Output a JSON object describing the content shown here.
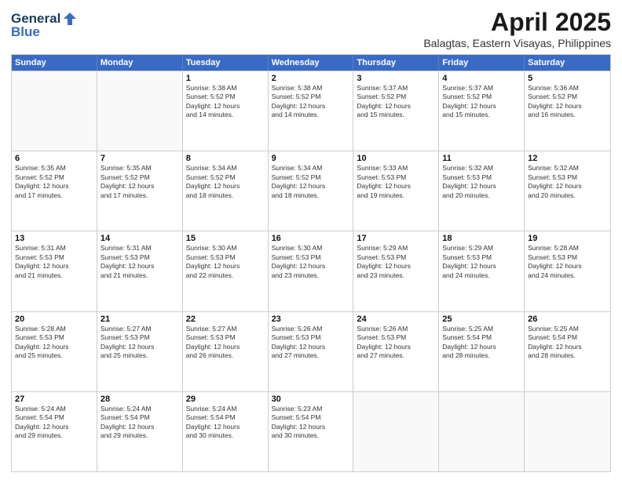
{
  "logo": {
    "line1": "General",
    "line2": "Blue"
  },
  "title": "April 2025",
  "subtitle": "Balagtas, Eastern Visayas, Philippines",
  "weekdays": [
    "Sunday",
    "Monday",
    "Tuesday",
    "Wednesday",
    "Thursday",
    "Friday",
    "Saturday"
  ],
  "weeks": [
    [
      {
        "day": "",
        "info": ""
      },
      {
        "day": "",
        "info": ""
      },
      {
        "day": "1",
        "info": "Sunrise: 5:38 AM\nSunset: 5:52 PM\nDaylight: 12 hours\nand 14 minutes."
      },
      {
        "day": "2",
        "info": "Sunrise: 5:38 AM\nSunset: 5:52 PM\nDaylight: 12 hours\nand 14 minutes."
      },
      {
        "day": "3",
        "info": "Sunrise: 5:37 AM\nSunset: 5:52 PM\nDaylight: 12 hours\nand 15 minutes."
      },
      {
        "day": "4",
        "info": "Sunrise: 5:37 AM\nSunset: 5:52 PM\nDaylight: 12 hours\nand 15 minutes."
      },
      {
        "day": "5",
        "info": "Sunrise: 5:36 AM\nSunset: 5:52 PM\nDaylight: 12 hours\nand 16 minutes."
      }
    ],
    [
      {
        "day": "6",
        "info": "Sunrise: 5:35 AM\nSunset: 5:52 PM\nDaylight: 12 hours\nand 17 minutes."
      },
      {
        "day": "7",
        "info": "Sunrise: 5:35 AM\nSunset: 5:52 PM\nDaylight: 12 hours\nand 17 minutes."
      },
      {
        "day": "8",
        "info": "Sunrise: 5:34 AM\nSunset: 5:52 PM\nDaylight: 12 hours\nand 18 minutes."
      },
      {
        "day": "9",
        "info": "Sunrise: 5:34 AM\nSunset: 5:52 PM\nDaylight: 12 hours\nand 18 minutes."
      },
      {
        "day": "10",
        "info": "Sunrise: 5:33 AM\nSunset: 5:53 PM\nDaylight: 12 hours\nand 19 minutes."
      },
      {
        "day": "11",
        "info": "Sunrise: 5:32 AM\nSunset: 5:53 PM\nDaylight: 12 hours\nand 20 minutes."
      },
      {
        "day": "12",
        "info": "Sunrise: 5:32 AM\nSunset: 5:53 PM\nDaylight: 12 hours\nand 20 minutes."
      }
    ],
    [
      {
        "day": "13",
        "info": "Sunrise: 5:31 AM\nSunset: 5:53 PM\nDaylight: 12 hours\nand 21 minutes."
      },
      {
        "day": "14",
        "info": "Sunrise: 5:31 AM\nSunset: 5:53 PM\nDaylight: 12 hours\nand 21 minutes."
      },
      {
        "day": "15",
        "info": "Sunrise: 5:30 AM\nSunset: 5:53 PM\nDaylight: 12 hours\nand 22 minutes."
      },
      {
        "day": "16",
        "info": "Sunrise: 5:30 AM\nSunset: 5:53 PM\nDaylight: 12 hours\nand 23 minutes."
      },
      {
        "day": "17",
        "info": "Sunrise: 5:29 AM\nSunset: 5:53 PM\nDaylight: 12 hours\nand 23 minutes."
      },
      {
        "day": "18",
        "info": "Sunrise: 5:29 AM\nSunset: 5:53 PM\nDaylight: 12 hours\nand 24 minutes."
      },
      {
        "day": "19",
        "info": "Sunrise: 5:28 AM\nSunset: 5:53 PM\nDaylight: 12 hours\nand 24 minutes."
      }
    ],
    [
      {
        "day": "20",
        "info": "Sunrise: 5:28 AM\nSunset: 5:53 PM\nDaylight: 12 hours\nand 25 minutes."
      },
      {
        "day": "21",
        "info": "Sunrise: 5:27 AM\nSunset: 5:53 PM\nDaylight: 12 hours\nand 25 minutes."
      },
      {
        "day": "22",
        "info": "Sunrise: 5:27 AM\nSunset: 5:53 PM\nDaylight: 12 hours\nand 26 minutes."
      },
      {
        "day": "23",
        "info": "Sunrise: 5:26 AM\nSunset: 5:53 PM\nDaylight: 12 hours\nand 27 minutes."
      },
      {
        "day": "24",
        "info": "Sunrise: 5:26 AM\nSunset: 5:53 PM\nDaylight: 12 hours\nand 27 minutes."
      },
      {
        "day": "25",
        "info": "Sunrise: 5:25 AM\nSunset: 5:54 PM\nDaylight: 12 hours\nand 28 minutes."
      },
      {
        "day": "26",
        "info": "Sunrise: 5:25 AM\nSunset: 5:54 PM\nDaylight: 12 hours\nand 28 minutes."
      }
    ],
    [
      {
        "day": "27",
        "info": "Sunrise: 5:24 AM\nSunset: 5:54 PM\nDaylight: 12 hours\nand 29 minutes."
      },
      {
        "day": "28",
        "info": "Sunrise: 5:24 AM\nSunset: 5:54 PM\nDaylight: 12 hours\nand 29 minutes."
      },
      {
        "day": "29",
        "info": "Sunrise: 5:24 AM\nSunset: 5:54 PM\nDaylight: 12 hours\nand 30 minutes."
      },
      {
        "day": "30",
        "info": "Sunrise: 5:23 AM\nSunset: 5:54 PM\nDaylight: 12 hours\nand 30 minutes."
      },
      {
        "day": "",
        "info": ""
      },
      {
        "day": "",
        "info": ""
      },
      {
        "day": "",
        "info": ""
      }
    ]
  ]
}
